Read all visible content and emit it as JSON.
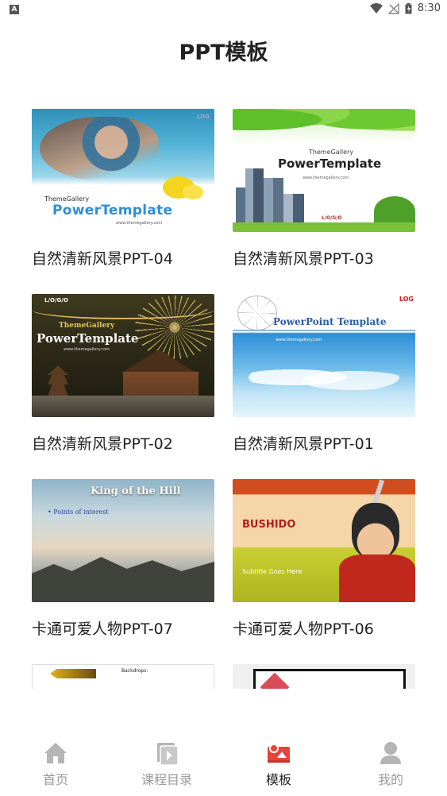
{
  "status_bar": {
    "left_badge": "A",
    "time": "8:30"
  },
  "page": {
    "title": "PPT模板"
  },
  "templates": [
    {
      "title": "自然清新风景PPT-04",
      "thumb_style": "water",
      "thumb_text": {
        "brand": "ThemeGallery",
        "title": "PowerTemplate",
        "url": "www.themegallery.com",
        "logo": "LOG"
      }
    },
    {
      "title": "自然清新风景PPT-03",
      "thumb_style": "city",
      "thumb_text": {
        "brand": "ThemeGallery",
        "title": "PowerTemplate",
        "url": "www.themegallery.com",
        "logo": "L/O/G/O"
      }
    },
    {
      "title": "自然清新风景PPT-02",
      "thumb_style": "temple",
      "thumb_text": {
        "brand": "ThemeGallery",
        "title": "PowerTemplate",
        "url": "www.themegallery.com",
        "logo": "L/O/G/O"
      }
    },
    {
      "title": "自然清新风景PPT-01",
      "thumb_style": "sky",
      "thumb_text": {
        "title": "PowerPoint Template",
        "url": "www.themegallery.com",
        "logo": "LOG"
      }
    },
    {
      "title": "卡通可爱人物PPT-07",
      "thumb_style": "hill",
      "thumb_text": {
        "title": "King of the Hill",
        "bullet": "• Points of interest"
      }
    },
    {
      "title": "卡通可爱人物PPT-06",
      "thumb_style": "bushido",
      "thumb_text": {
        "title": "BUSHIDO",
        "subtitle": "Subtitle Goes Here"
      }
    },
    {
      "title": "",
      "thumb_style": "anim",
      "thumb_text": {
        "heading": "Backdrops:"
      }
    },
    {
      "title": "",
      "thumb_style": "screen",
      "thumb_text": {}
    }
  ],
  "bottom_nav": {
    "items": [
      {
        "label": "首页",
        "icon": "home-icon",
        "active": false
      },
      {
        "label": "课程目录",
        "icon": "course-catalog-icon",
        "active": false
      },
      {
        "label": "模板",
        "icon": "template-icon",
        "active": true
      },
      {
        "label": "我的",
        "icon": "profile-icon",
        "active": false
      }
    ]
  },
  "colors": {
    "accent": "#e8443a",
    "inactive": "#9a9a9a",
    "text": "#222222"
  }
}
